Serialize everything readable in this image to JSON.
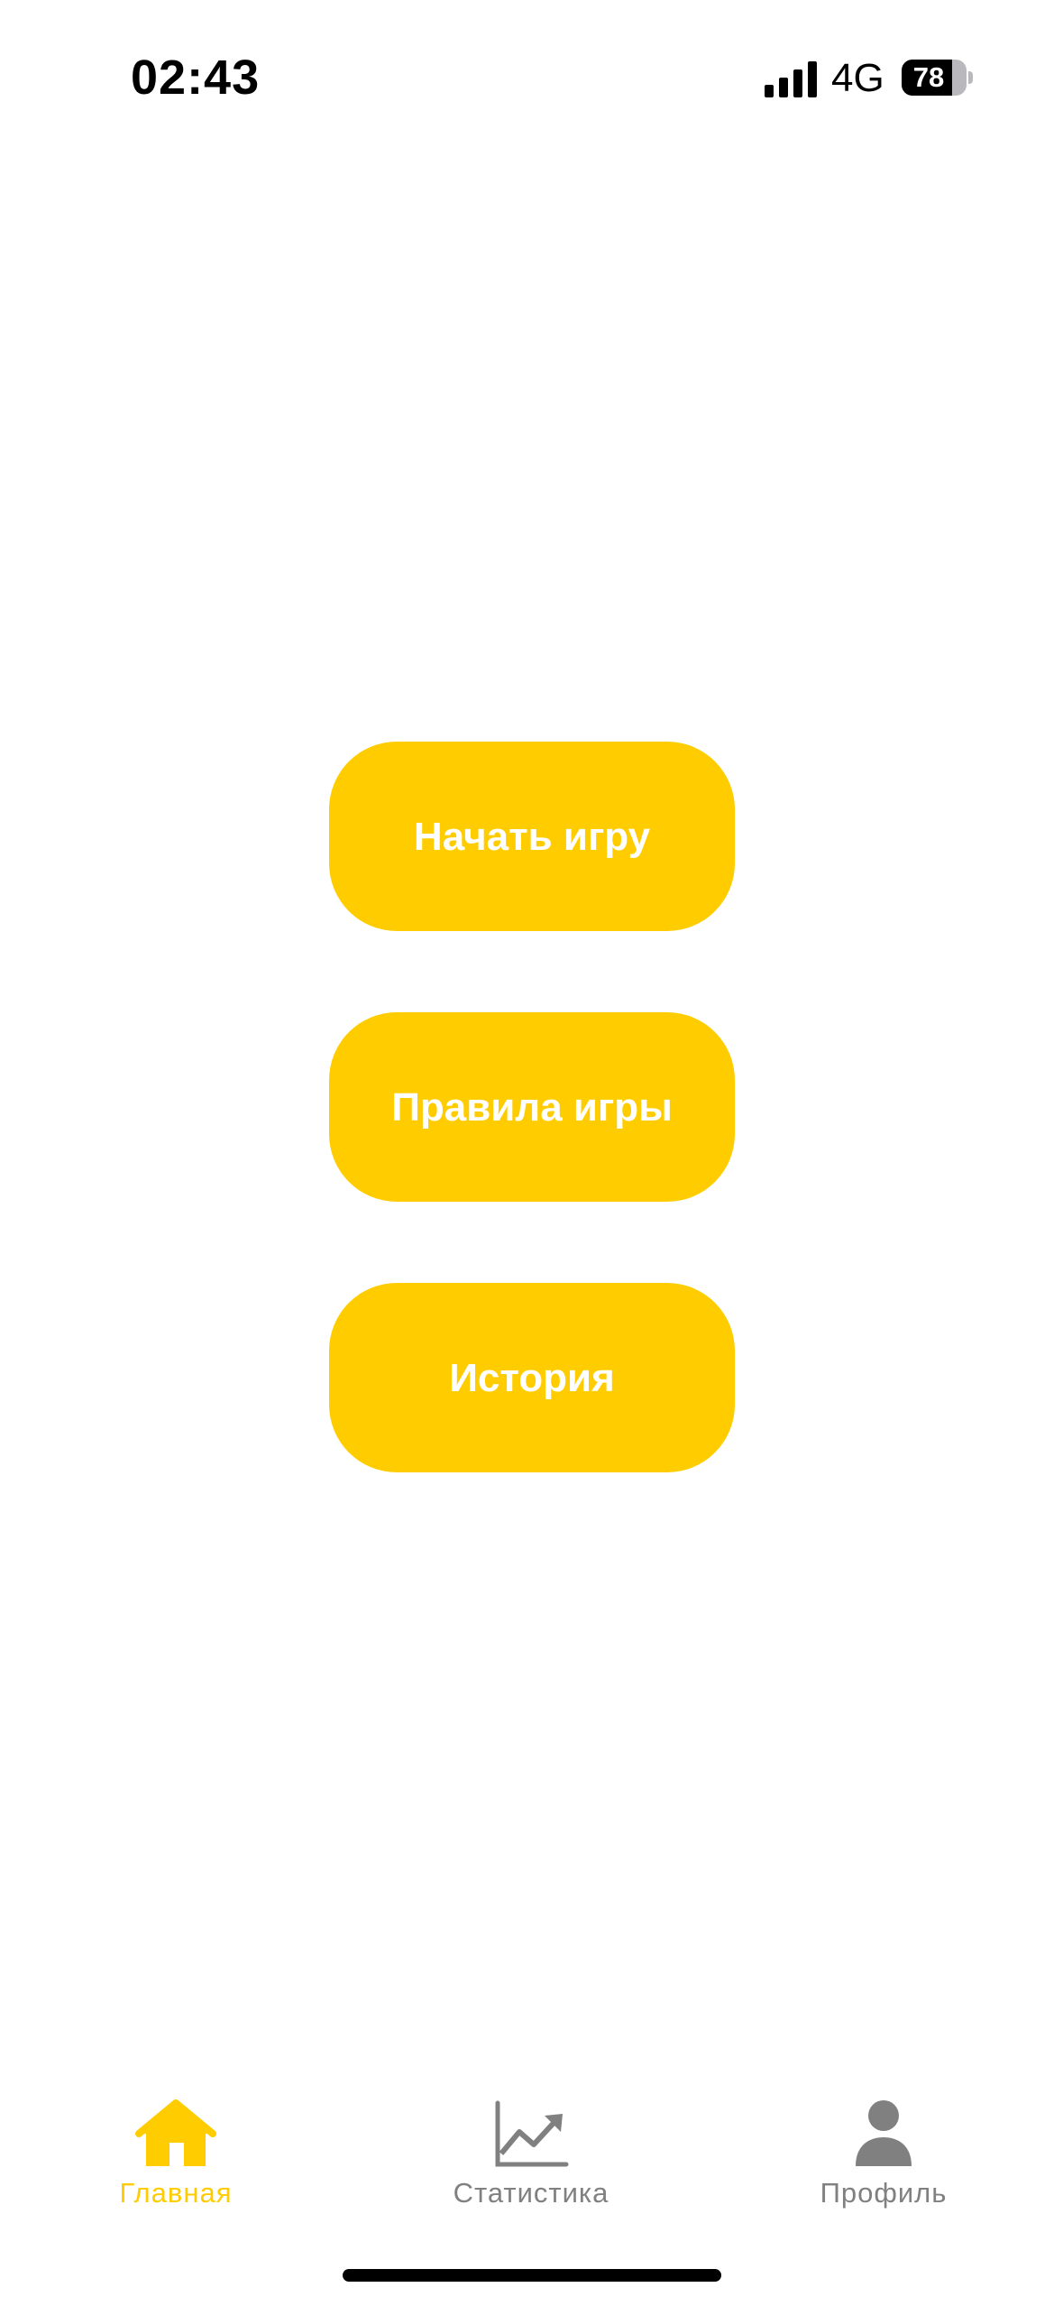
{
  "status_bar": {
    "time": "02:43",
    "network": "4G",
    "battery_level": "78",
    "battery_fraction": 0.78
  },
  "menu": {
    "buttons": [
      {
        "label": "Начать игру"
      },
      {
        "label": "Правила игры"
      },
      {
        "label": "История"
      }
    ],
    "button_color": "#ffcc00"
  },
  "tab_bar": {
    "active_color": "#ffcc00",
    "inactive_color": "#808080",
    "tabs": [
      {
        "label": "Главная",
        "icon": "home-icon",
        "active": true
      },
      {
        "label": "Статистика",
        "icon": "chart-trend-icon",
        "active": false
      },
      {
        "label": "Профиль",
        "icon": "person-icon",
        "active": false
      }
    ]
  }
}
